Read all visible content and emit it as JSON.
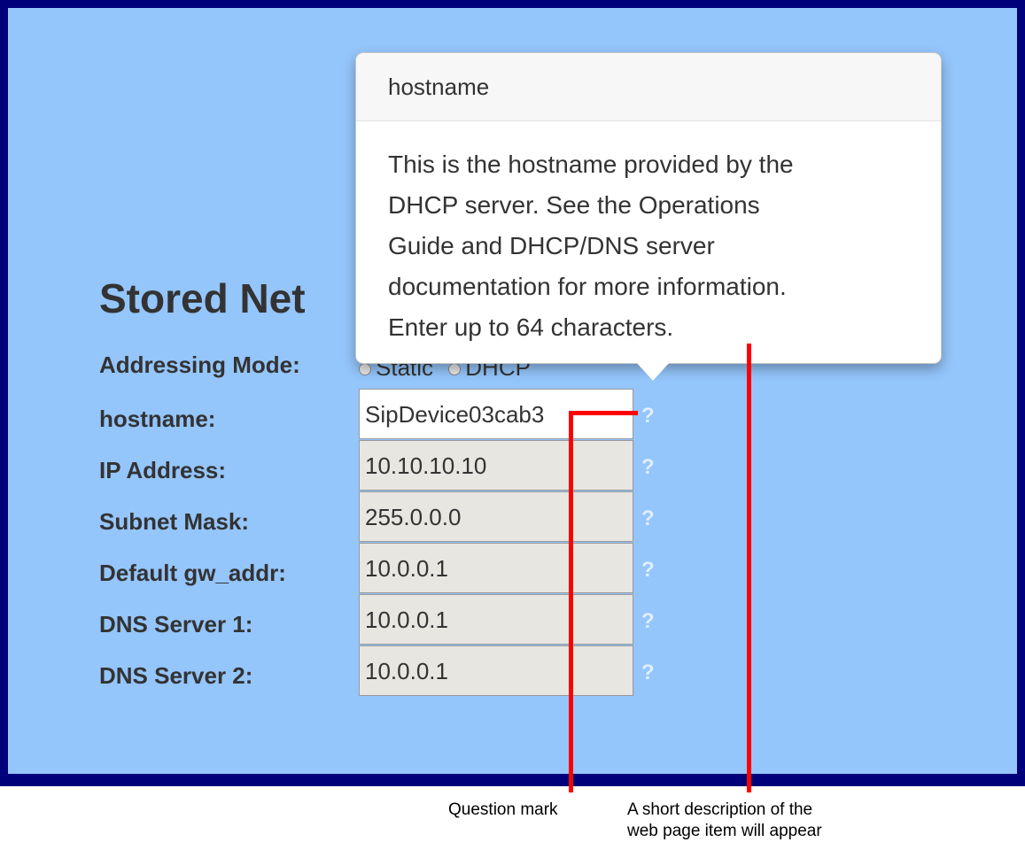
{
  "section_title": "Stored Net",
  "addressing_mode": {
    "label": "Addressing Mode:",
    "options": [
      "Static",
      "DHCP"
    ]
  },
  "fields": [
    {
      "label": "hostname:",
      "value": "SipDevice03cab3",
      "help": "?"
    },
    {
      "label": "IP Address:",
      "value": "10.10.10.10",
      "help": "?"
    },
    {
      "label": "Subnet Mask:",
      "value": "255.0.0.0",
      "help": "?"
    },
    {
      "label": "Default gw_addr:",
      "value": "10.0.0.1",
      "help": "?"
    },
    {
      "label": "DNS Server 1:",
      "value": "10.0.0.1",
      "help": "?"
    },
    {
      "label": "DNS Server 2:",
      "value": "10.0.0.1",
      "help": "?"
    }
  ],
  "popover": {
    "title": "hostname",
    "body_lines": [
      "This is the hostname provided by the",
      "DHCP server. See the Operations",
      "Guide and DHCP/DNS server",
      "documentation for more information.",
      "Enter up to 64 characters."
    ]
  },
  "callouts": {
    "question_mark": "Question mark",
    "description_lines": [
      "A short description of the",
      "web page item will appear"
    ]
  },
  "colors": {
    "frame_border": "#00007a",
    "background": "#94c5fb",
    "callout_line": "#ff0000"
  }
}
